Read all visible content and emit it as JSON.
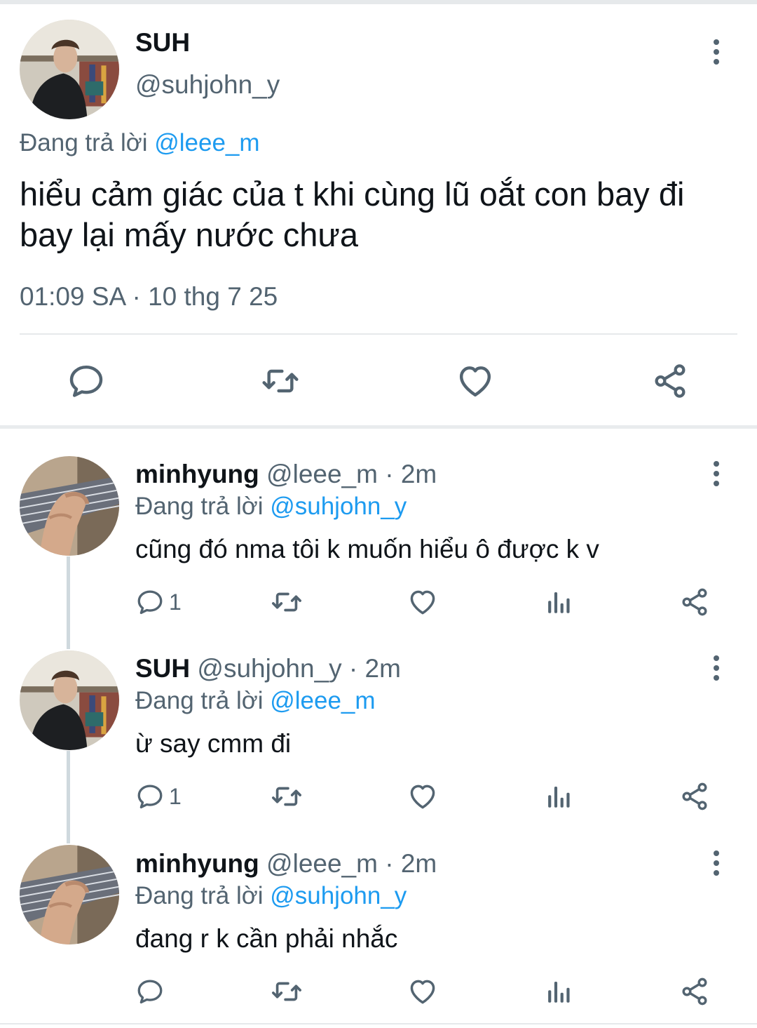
{
  "main": {
    "name": "SUH",
    "handle": "@suhjohn_y",
    "reply_prefix": "Đang trả lời",
    "reply_to": "@leee_m",
    "text": "hiểu cảm giác của t khi cùng lũ oắt con bay đi bay lại mấy nước chưa",
    "timestamp": "01:09 SA · 10 thg 7 25",
    "actions": [
      "reply-icon",
      "retweet-icon",
      "like-icon",
      "share-icon"
    ]
  },
  "replies": [
    {
      "name": "minhyung",
      "handle": "@leee_m · 2m",
      "reply_prefix": "Đang trả lời",
      "reply_to": "@suhjohn_y",
      "text": "cũng đó nma tôi k muốn hiểu ô được k v",
      "reply_count": "1"
    },
    {
      "name": "SUH",
      "handle": "@suhjohn_y · 2m",
      "reply_prefix": "Đang trả lời",
      "reply_to": "@leee_m",
      "text": "ừ say cmm đi",
      "reply_count": "1"
    },
    {
      "name": "minhyung",
      "handle": "@leee_m · 2m",
      "reply_prefix": "Đang trả lời",
      "reply_to": "@suhjohn_y",
      "text": "đang r k cần phải nhắc",
      "reply_count": ""
    }
  ],
  "colors": {
    "text": "#0f1419",
    "secondary": "#536471",
    "link": "#1d9bf0",
    "divider": "#e6e9eb"
  }
}
